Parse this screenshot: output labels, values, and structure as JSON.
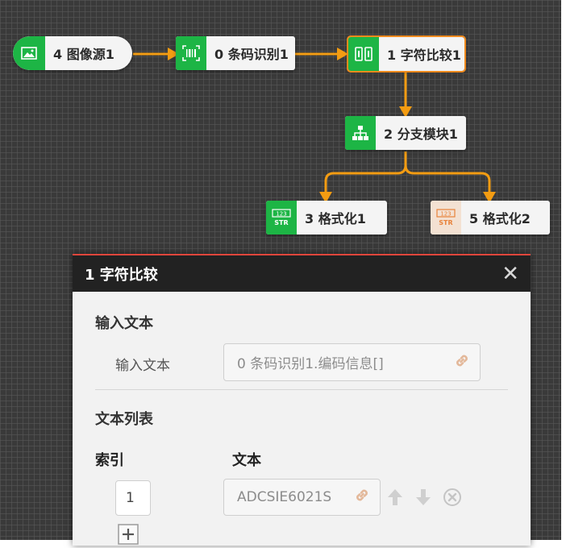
{
  "nodes": {
    "image_source": {
      "label": "4 图像源1",
      "icon": "image-icon"
    },
    "barcode": {
      "label": "0 条码识别1",
      "icon": "barcode-scan-icon"
    },
    "string_compare": {
      "label": "1 字符比较1",
      "icon": "string-compare-icon"
    },
    "branch": {
      "label": "2 分支模块1",
      "icon": "branch-icon"
    },
    "format1": {
      "label": "3 格式化1",
      "icon": "format-str-icon"
    },
    "format2": {
      "label": "5 格式化2",
      "icon": "format-str-icon"
    }
  },
  "colors": {
    "accent_green": "#1db545",
    "wire_orange": "#f39c12",
    "selected_border": "#f08a1d",
    "panel_top": "#e0463c"
  },
  "panel": {
    "title": "1 字符比较",
    "input_section": {
      "title": "输入文本",
      "field_label": "输入文本",
      "field_value": "0 条码识别1.编码信息[]"
    },
    "list_section": {
      "title": "文本列表",
      "col_index": "索引",
      "col_text": "文本",
      "rows": [
        {
          "index": "1",
          "text": "ADCSIE6021S"
        }
      ]
    }
  }
}
